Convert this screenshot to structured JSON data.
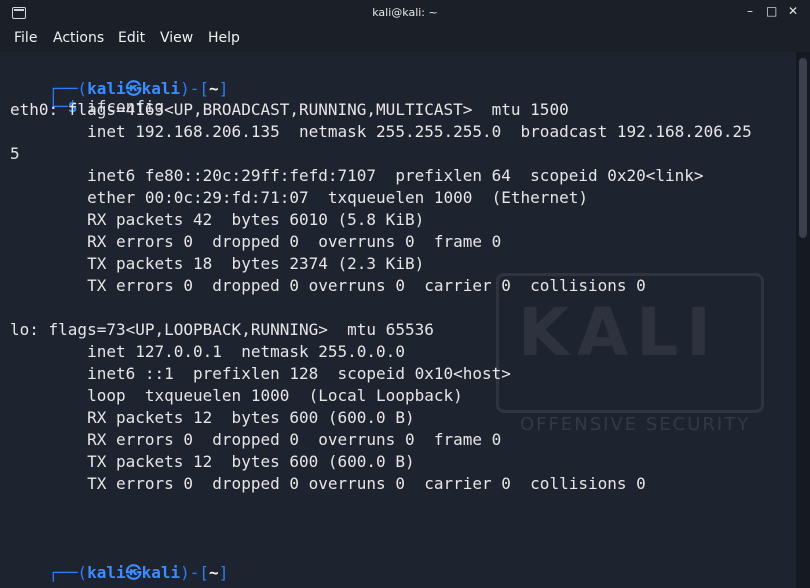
{
  "window": {
    "title": "kali@kali: ~",
    "minimize_glyph": "–",
    "maximize_glyph": "□",
    "close_glyph": "✕"
  },
  "menu": {
    "items": [
      "File",
      "Actions",
      "Edit",
      "View",
      "Help"
    ]
  },
  "prompt": {
    "user": "kali",
    "host": "kali",
    "dir": "~",
    "symbol": "$",
    "command": "ifconfig"
  },
  "output": {
    "lines": [
      "eth0: flags=4163<UP,BROADCAST,RUNNING,MULTICAST>  mtu 1500",
      "        inet 192.168.206.135  netmask 255.255.255.0  broadcast 192.168.206.25",
      "5",
      "        inet6 fe80::20c:29ff:fefd:7107  prefixlen 64  scopeid 0x20<link>",
      "        ether 00:0c:29:fd:71:07  txqueuelen 1000  (Ethernet)",
      "        RX packets 42  bytes 6010 (5.8 KiB)",
      "        RX errors 0  dropped 0  overruns 0  frame 0",
      "        TX packets 18  bytes 2374 (2.3 KiB)",
      "        TX errors 0  dropped 0 overruns 0  carrier 0  collisions 0",
      "",
      "lo: flags=73<UP,LOOPBACK,RUNNING>  mtu 65536",
      "        inet 127.0.0.1  netmask 255.0.0.0",
      "        inet6 ::1  prefixlen 128  scopeid 0x10<host>",
      "        loop  txqueuelen 1000  (Local Loopback)",
      "        RX packets 12  bytes 600 (600.0 B)",
      "        RX errors 0  dropped 0  overruns 0  frame 0",
      "        TX packets 12  bytes 600 (600.0 B)",
      "        TX errors 0  dropped 0 overruns 0  carrier 0  collisions 0"
    ]
  },
  "watermark": {
    "logo_text": "KALI",
    "subtitle": "OFFENSIVE SECURITY"
  },
  "colors": {
    "background": "#1e2330",
    "bar": "#1b1f27",
    "prompt_blue": "#2f7cf6",
    "text": "#e6e6e6"
  }
}
